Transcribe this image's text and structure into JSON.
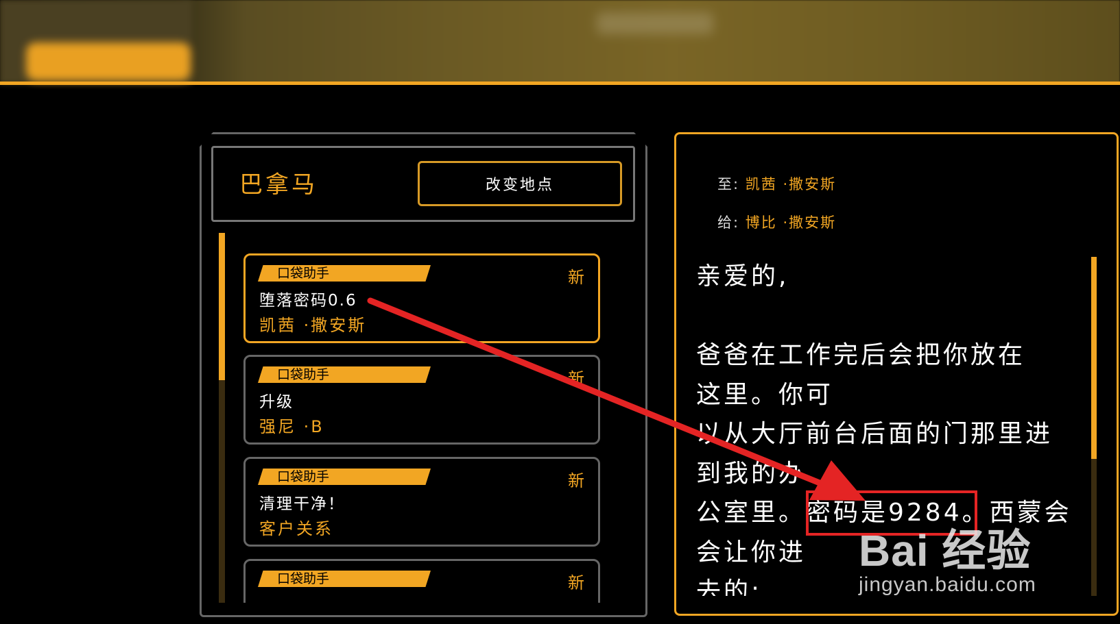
{
  "location": {
    "name": "巴拿马",
    "change_button": "改变地点"
  },
  "messages": [
    {
      "tag": "口袋助手",
      "new": "新",
      "subject": "堕落密码0.6",
      "sender": "凯茜 ·撒安斯",
      "active": true
    },
    {
      "tag": "口袋助手",
      "new": "新",
      "subject": "升级",
      "sender": "强尼 ·B",
      "active": false
    },
    {
      "tag": "口袋助手",
      "new": "新",
      "subject": "清理干净！",
      "sender": "客户关系",
      "active": false
    },
    {
      "tag": "口袋助手",
      "new": "新",
      "subject": "",
      "sender": "",
      "active": false
    }
  ],
  "letter": {
    "to_label": "至:",
    "to_value": "凯茜 ·撒安斯",
    "from_label": "给:",
    "from_value": "博比 ·撒安斯",
    "lines": [
      "亲爱的,",
      "",
      "爸爸在工作完后会把你放在",
      "这里。你可",
      "以从大厅前台后面的门那里进",
      "到我的办",
      "公室里。密码是9284。西蒙会",
      "会让你进",
      "去的:"
    ]
  },
  "annotation": {
    "highlight_text": "密码是9284",
    "color": "#e42424"
  },
  "watermark": {
    "main": "Bai 经验",
    "sub": "jingyan.baidu.com"
  },
  "colors": {
    "accent": "#f2a623",
    "background": "#000000"
  }
}
